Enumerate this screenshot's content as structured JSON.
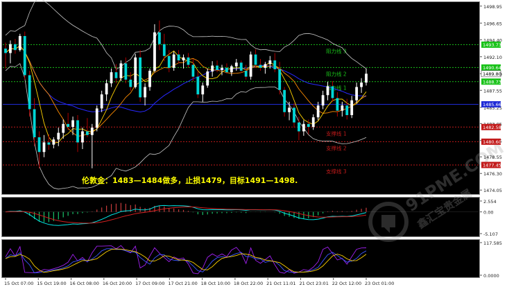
{
  "colors": {
    "background": "#000000",
    "candle_up": "#ffffff",
    "candle_down": "#00d6d6",
    "bearish_tick": "#b00000",
    "bollinger": "#c8c8c8",
    "ma_fast": "#ffd200",
    "ma_mid": "#ff8c00",
    "ma_slow": "#2828ff",
    "resistance": "#19c219",
    "support": "#c21a1a",
    "blue_line": "#1f2bd6",
    "annotation": "#ffff00",
    "macd_line_red": "#d42020",
    "macd_line_cyan": "#00e6e6",
    "macd_bar_green": "#18c36a",
    "macd_bar_red": "#c63b3b",
    "osc_blue": "#3a56ff",
    "osc_yellow": "#ffd200",
    "osc_purple": "#a020f0"
  },
  "main_panel": {
    "price_axis": [
      "1498.95",
      "1496.65",
      "1494.40",
      "1492.10",
      "1489.80",
      "1487.55",
      "1485.25",
      "1483.05",
      "1480.75",
      "1478.55",
      "1476.30",
      "1474.05"
    ],
    "price_range": [
      1473.6,
      1499.4
    ],
    "price_tags": [
      {
        "value": "1493.73",
        "price": 1493.73,
        "color": "#19c219"
      },
      {
        "value": "1490.64",
        "price": 1490.64,
        "color": "#19c219"
      },
      {
        "value": "1489.80",
        "price": 1489.8,
        "color": "#ffffff"
      },
      {
        "value": "1488.73",
        "price": 1488.73,
        "color": "#19c219"
      },
      {
        "value": "1485.66",
        "price": 1485.66,
        "color": "#1f2bd6"
      },
      {
        "value": "1482.58",
        "price": 1482.58,
        "color": "#c21a1a"
      },
      {
        "value": "1480.60",
        "price": 1480.6,
        "color": "#c21a1a"
      },
      {
        "value": "1477.45",
        "price": 1477.45,
        "color": "#c21a1a"
      }
    ],
    "levels": [
      {
        "label": "阻力线 3",
        "price": 1493.73,
        "kind": "resistance"
      },
      {
        "label": "阻力线 2",
        "price": 1490.64,
        "kind": "resistance"
      },
      {
        "label": "阻力线 1",
        "price": 1488.73,
        "kind": "resistance"
      },
      {
        "label": "支撑线 1",
        "price": 1482.58,
        "kind": "support"
      },
      {
        "label": "支撑线 2",
        "price": 1480.6,
        "kind": "support"
      },
      {
        "label": "支撑线 3",
        "price": 1477.45,
        "kind": "support"
      }
    ],
    "blue_line_price": 1485.66,
    "annotation": "伦敦金：1483—1484做多，止损1479，目标1491—1498."
  },
  "macd_panel": {
    "axis": [
      "2.554",
      "0.00",
      "-5.107"
    ],
    "range": [
      -5.6,
      3.2
    ]
  },
  "osc_panel": {
    "axis": [
      "117.585",
      "0.0000"
    ],
    "range": [
      -5,
      125
    ]
  },
  "time_axis": [
    "15 Oct 07:00",
    "15 Oct 19:00",
    "16 Oct 08:00",
    "16 Oct 20:00",
    "17 Oct 09:00",
    "17 Oct 21:00",
    "18 Oct 10:00",
    "18 Oct 22:00",
    "21 Oct 11:01",
    "21 Oct 23:01",
    "22 Oct 12:00",
    "23 Oct 01:00"
  ],
  "watermark": {
    "text": "91PME.COM",
    "sub": "鑫汇宝贵金属"
  },
  "candles": [
    {
      "o": 1493.2,
      "h": 1494.0,
      "l": 1490.5,
      "c": 1492.6
    },
    {
      "o": 1492.6,
      "h": 1494.3,
      "l": 1491.2,
      "c": 1493.8
    },
    {
      "o": 1493.8,
      "h": 1494.5,
      "l": 1492.5,
      "c": 1493.0
    },
    {
      "o": 1493.0,
      "h": 1495.2,
      "l": 1492.8,
      "c": 1494.9
    },
    {
      "o": 1494.9,
      "h": 1495.5,
      "l": 1489.0,
      "c": 1489.6
    },
    {
      "o": 1489.6,
      "h": 1490.2,
      "l": 1484.0,
      "c": 1485.0
    },
    {
      "o": 1485.0,
      "h": 1486.5,
      "l": 1480.0,
      "c": 1481.2
    },
    {
      "o": 1481.2,
      "h": 1482.0,
      "l": 1477.0,
      "c": 1479.2
    },
    {
      "o": 1479.2,
      "h": 1481.5,
      "l": 1478.5,
      "c": 1480.5
    },
    {
      "o": 1480.5,
      "h": 1481.6,
      "l": 1479.5,
      "c": 1480.2
    },
    {
      "o": 1480.2,
      "h": 1481.2,
      "l": 1479.7,
      "c": 1480.9
    },
    {
      "o": 1480.9,
      "h": 1482.5,
      "l": 1480.0,
      "c": 1481.8
    },
    {
      "o": 1481.8,
      "h": 1483.6,
      "l": 1481.0,
      "c": 1483.0
    },
    {
      "o": 1483.0,
      "h": 1484.5,
      "l": 1482.2,
      "c": 1482.6
    },
    {
      "o": 1482.6,
      "h": 1484.0,
      "l": 1481.5,
      "c": 1483.5
    },
    {
      "o": 1483.5,
      "h": 1484.2,
      "l": 1479.2,
      "c": 1480.5
    },
    {
      "o": 1480.5,
      "h": 1482.5,
      "l": 1479.6,
      "c": 1482.0
    },
    {
      "o": 1482.0,
      "h": 1483.8,
      "l": 1481.2,
      "c": 1481.5
    },
    {
      "o": 1481.5,
      "h": 1483.0,
      "l": 1477.0,
      "c": 1482.5
    },
    {
      "o": 1482.5,
      "h": 1485.5,
      "l": 1482.0,
      "c": 1485.1
    },
    {
      "o": 1485.1,
      "h": 1487.5,
      "l": 1484.6,
      "c": 1487.0
    },
    {
      "o": 1487.0,
      "h": 1489.0,
      "l": 1486.1,
      "c": 1488.5
    },
    {
      "o": 1488.5,
      "h": 1490.5,
      "l": 1488.0,
      "c": 1490.0
    },
    {
      "o": 1490.0,
      "h": 1491.1,
      "l": 1488.5,
      "c": 1489.2
    },
    {
      "o": 1489.2,
      "h": 1491.6,
      "l": 1488.8,
      "c": 1491.2
    },
    {
      "o": 1491.2,
      "h": 1492.0,
      "l": 1488.5,
      "c": 1489.0
    },
    {
      "o": 1489.0,
      "h": 1490.0,
      "l": 1487.5,
      "c": 1488.0
    },
    {
      "o": 1488.0,
      "h": 1492.5,
      "l": 1487.8,
      "c": 1492.0
    },
    {
      "o": 1492.0,
      "h": 1493.0,
      "l": 1486.0,
      "c": 1486.6
    },
    {
      "o": 1486.6,
      "h": 1488.5,
      "l": 1485.5,
      "c": 1488.0
    },
    {
      "o": 1488.0,
      "h": 1490.5,
      "l": 1487.5,
      "c": 1490.2
    },
    {
      "o": 1490.2,
      "h": 1496.5,
      "l": 1490.0,
      "c": 1495.4
    },
    {
      "o": 1495.4,
      "h": 1497.0,
      "l": 1493.0,
      "c": 1493.8
    },
    {
      "o": 1493.8,
      "h": 1495.2,
      "l": 1491.5,
      "c": 1492.2
    },
    {
      "o": 1492.2,
      "h": 1493.0,
      "l": 1490.0,
      "c": 1490.6
    },
    {
      "o": 1490.6,
      "h": 1492.8,
      "l": 1490.2,
      "c": 1492.4
    },
    {
      "o": 1492.4,
      "h": 1493.0,
      "l": 1491.2,
      "c": 1491.6
    },
    {
      "o": 1491.6,
      "h": 1492.4,
      "l": 1490.5,
      "c": 1492.0
    },
    {
      "o": 1492.0,
      "h": 1492.6,
      "l": 1490.6,
      "c": 1491.0
    },
    {
      "o": 1491.0,
      "h": 1491.8,
      "l": 1488.8,
      "c": 1489.4
    },
    {
      "o": 1489.4,
      "h": 1490.2,
      "l": 1486.5,
      "c": 1487.0
    },
    {
      "o": 1487.0,
      "h": 1488.6,
      "l": 1486.0,
      "c": 1488.2
    },
    {
      "o": 1488.2,
      "h": 1490.5,
      "l": 1487.9,
      "c": 1490.1
    },
    {
      "o": 1490.1,
      "h": 1491.5,
      "l": 1489.4,
      "c": 1490.9
    },
    {
      "o": 1490.9,
      "h": 1491.6,
      "l": 1490.0,
      "c": 1490.3
    },
    {
      "o": 1490.3,
      "h": 1491.0,
      "l": 1489.6,
      "c": 1490.6
    },
    {
      "o": 1490.6,
      "h": 1491.2,
      "l": 1489.8,
      "c": 1490.0
    },
    {
      "o": 1490.0,
      "h": 1491.0,
      "l": 1489.5,
      "c": 1490.8
    },
    {
      "o": 1490.8,
      "h": 1491.8,
      "l": 1490.2,
      "c": 1491.3
    },
    {
      "o": 1491.3,
      "h": 1491.6,
      "l": 1489.9,
      "c": 1490.2
    },
    {
      "o": 1490.2,
      "h": 1491.0,
      "l": 1489.0,
      "c": 1489.4
    },
    {
      "o": 1489.4,
      "h": 1492.8,
      "l": 1489.0,
      "c": 1492.4
    },
    {
      "o": 1492.4,
      "h": 1493.1,
      "l": 1490.6,
      "c": 1491.0
    },
    {
      "o": 1491.0,
      "h": 1491.8,
      "l": 1490.2,
      "c": 1490.6
    },
    {
      "o": 1490.6,
      "h": 1491.4,
      "l": 1489.8,
      "c": 1491.1
    },
    {
      "o": 1491.1,
      "h": 1492.2,
      "l": 1490.5,
      "c": 1491.6
    },
    {
      "o": 1491.6,
      "h": 1492.6,
      "l": 1490.0,
      "c": 1490.4
    },
    {
      "o": 1490.4,
      "h": 1491.4,
      "l": 1487.0,
      "c": 1487.6
    },
    {
      "o": 1487.6,
      "h": 1488.0,
      "l": 1484.0,
      "c": 1484.6
    },
    {
      "o": 1484.6,
      "h": 1486.0,
      "l": 1483.5,
      "c": 1485.2
    },
    {
      "o": 1485.2,
      "h": 1485.8,
      "l": 1482.5,
      "c": 1483.2
    },
    {
      "o": 1483.2,
      "h": 1484.0,
      "l": 1480.8,
      "c": 1482.0
    },
    {
      "o": 1482.0,
      "h": 1483.5,
      "l": 1481.4,
      "c": 1483.0
    },
    {
      "o": 1483.0,
      "h": 1483.6,
      "l": 1481.6,
      "c": 1482.6
    },
    {
      "o": 1482.6,
      "h": 1484.3,
      "l": 1482.2,
      "c": 1483.9
    },
    {
      "o": 1483.9,
      "h": 1486.0,
      "l": 1483.5,
      "c": 1485.5
    },
    {
      "o": 1485.5,
      "h": 1487.5,
      "l": 1485.0,
      "c": 1486.9
    },
    {
      "o": 1486.9,
      "h": 1488.7,
      "l": 1486.2,
      "c": 1488.1
    },
    {
      "o": 1488.1,
      "h": 1488.8,
      "l": 1486.0,
      "c": 1486.5
    },
    {
      "o": 1486.5,
      "h": 1487.3,
      "l": 1484.0,
      "c": 1484.8
    },
    {
      "o": 1484.8,
      "h": 1486.0,
      "l": 1484.0,
      "c": 1485.5
    },
    {
      "o": 1485.5,
      "h": 1486.4,
      "l": 1483.6,
      "c": 1484.2
    },
    {
      "o": 1484.2,
      "h": 1486.8,
      "l": 1483.8,
      "c": 1486.2
    },
    {
      "o": 1486.2,
      "h": 1488.6,
      "l": 1485.8,
      "c": 1488.0
    },
    {
      "o": 1488.0,
      "h": 1489.2,
      "l": 1487.2,
      "c": 1488.6
    },
    {
      "o": 1488.6,
      "h": 1490.5,
      "l": 1488.2,
      "c": 1489.8
    }
  ]
}
